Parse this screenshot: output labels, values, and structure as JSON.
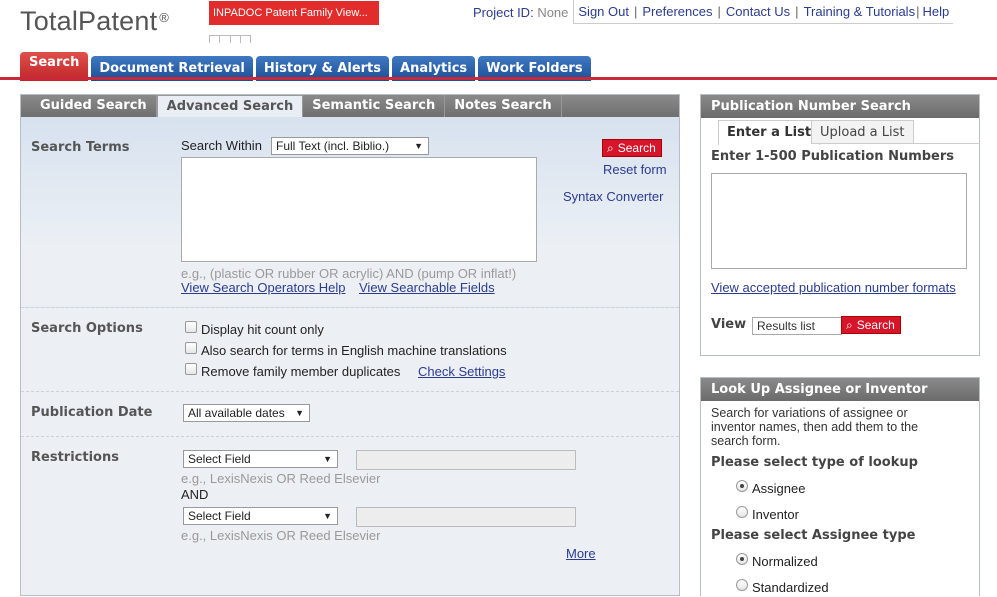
{
  "brand": {
    "name": "TotalPatent",
    "reg": "®"
  },
  "banner": {
    "inpadoc": "INPADOC Patent Family View..."
  },
  "topbar": {
    "project_label": "Project ID:",
    "project_value": "None",
    "links": [
      "Sign Out",
      "Preferences",
      "Contact Us",
      "Training & Tutorials",
      "Help"
    ]
  },
  "main_tabs": [
    "Search",
    "Document Retrieval",
    "History & Alerts",
    "Analytics",
    "Work Folders"
  ],
  "sub_tabs": [
    "Guided Search",
    "Advanced Search",
    "Semantic Search",
    "Notes Search"
  ],
  "search_terms": {
    "label": "Search Terms",
    "within_label": "Search Within",
    "within_value": "Full Text (incl. Biblio.)",
    "search_button": "Search",
    "reset": "Reset form",
    "syntax": "Syntax Converter",
    "example": "e.g., (plastic OR rubber OR acrylic) AND (pump OR inflat!)",
    "help_link": "View Search Operators Help",
    "fields_link": "View Searchable Fields"
  },
  "search_options": {
    "label": "Search Options",
    "opt1": "Display hit count only",
    "opt2": "Also search for terms in English machine translations",
    "opt3": "Remove family member duplicates",
    "check_settings": "Check Settings"
  },
  "publication_date": {
    "label": "Publication Date",
    "value": "All available dates"
  },
  "restrictions": {
    "label": "Restrictions",
    "select1": "Select Field",
    "example1": "e.g., LexisNexis OR Reed Elsevier",
    "and": "AND",
    "select2": "Select Field",
    "example2": "e.g., LexisNexis OR Reed Elsevier",
    "more": "More"
  },
  "pubnum": {
    "title": "Publication Number Search",
    "tab_enter": "Enter a List",
    "tab_upload": "Upload a List",
    "instruction": "Enter 1-500 Publication Numbers",
    "formats_link": "View accepted publication number formats",
    "view_label": "View",
    "view_value": "Results list",
    "search_button": "Search"
  },
  "lookup": {
    "title": "Look Up Assignee or Inventor",
    "desc_line1": "Search for variations of assignee or",
    "desc_line2": "inventor names, then add them to the",
    "desc_line3": "search form.",
    "type_label": "Please select type of lookup",
    "type_assignee": "Assignee",
    "type_inventor": "Inventor",
    "assignee_label": "Please select Assignee type",
    "normalized": "Normalized",
    "standardized": "Standardized"
  },
  "colors": {
    "accent_red": "#c8283a",
    "tab_blue": "#1c4f94",
    "link": "#2b3b8f"
  }
}
